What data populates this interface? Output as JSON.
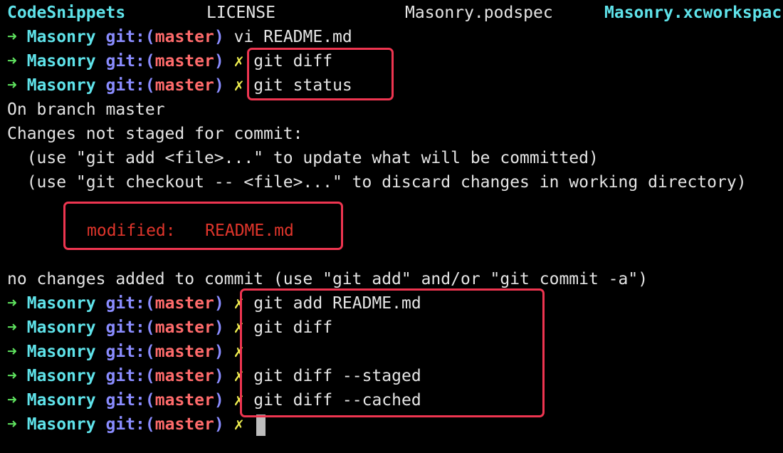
{
  "ls": {
    "items": [
      "CodeSnippets",
      "LICENSE",
      "Masonry.podspec",
      "Masonry.xcworkspac"
    ]
  },
  "prompt": {
    "arrow": "➜",
    "dir": "Masonry",
    "git_open": "git:(",
    "branch": "master",
    "git_close": ")",
    "dirty": "✗"
  },
  "lines": {
    "cmd1": "vi README.md",
    "cmd2": "git diff",
    "cmd3": "git status",
    "out1": "On branch master",
    "out2": "Changes not staged for commit:",
    "out3": "  (use \"git add <file>...\" to update what will be committed)",
    "out4": "  (use \"git checkout -- <file>...\" to discard changes in working directory)",
    "modified_label": "modified:",
    "modified_file": "README.md",
    "out5": "no changes added to commit (use \"git add\" and/or \"git commit -a\")",
    "cmd4": "git add README.md",
    "cmd5": "git diff",
    "cmd6": "",
    "cmd7": "git diff --staged",
    "cmd8": "git diff --cached",
    "cmd9": ""
  },
  "colors": {
    "background": "#000000",
    "arrow": "#5fe35f",
    "dir": "#5fe3ea",
    "git": "#8a8cff",
    "branch": "#ff6b6b",
    "dirty": "#f0f050",
    "modified": "#e0352b",
    "highlight_box": "#ee3550"
  }
}
